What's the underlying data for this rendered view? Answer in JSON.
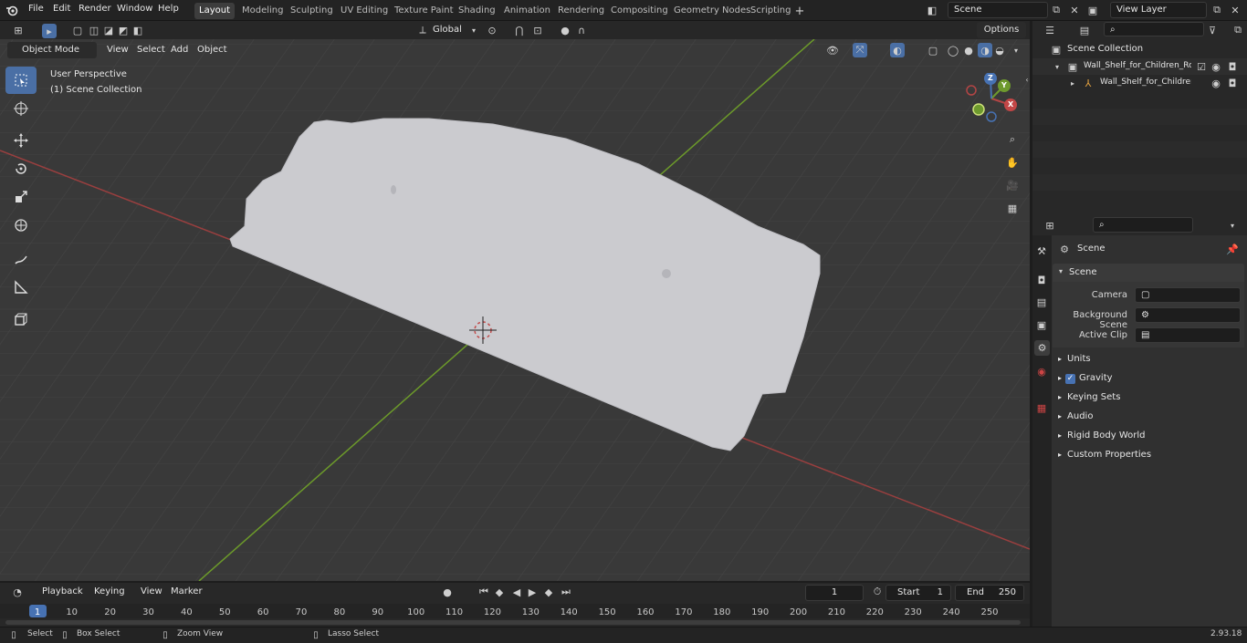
{
  "menu": {
    "items": [
      "File",
      "Edit",
      "Render",
      "Window",
      "Help"
    ]
  },
  "workspaces": [
    "Layout",
    "Modeling",
    "Sculpting",
    "UV Editing",
    "Texture Paint",
    "Shading",
    "Animation",
    "Rendering",
    "Compositing",
    "Geometry Nodes",
    "Scripting"
  ],
  "active_workspace": "Layout",
  "scene_field": "Scene",
  "view_layer_field": "View Layer",
  "header": {
    "transform_orientation": "Global",
    "options": "Options"
  },
  "viewport_header": {
    "mode": "Object Mode",
    "menus": [
      "View",
      "Select",
      "Add",
      "Object"
    ]
  },
  "viewport": {
    "perspective": "User Perspective",
    "collection": "(1) Scene Collection"
  },
  "gizmo": {
    "x": "X",
    "y": "Y",
    "z": "Z"
  },
  "outliner": {
    "root": "Scene Collection",
    "items": [
      "Wall_Shelf_for_Children_Roor",
      "Wall_Shelf_for_Children_I"
    ]
  },
  "properties": {
    "context": "Scene",
    "panel": "Scene",
    "camera_label": "Camera",
    "bg_scene_label": "Background Scene",
    "active_clip_label": "Active Clip",
    "sections": [
      "Units",
      "Gravity",
      "Keying Sets",
      "Audio",
      "Rigid Body World",
      "Custom Properties"
    ],
    "gravity_checked": true
  },
  "timeline": {
    "menus": [
      "Playback",
      "Keying",
      "View",
      "Marker"
    ],
    "current_frame": "1",
    "start_label": "Start",
    "start": "1",
    "end_label": "End",
    "end": "250",
    "ticks": [
      "1",
      "10",
      "20",
      "30",
      "40",
      "50",
      "60",
      "70",
      "80",
      "90",
      "100",
      "110",
      "120",
      "130",
      "140",
      "150",
      "160",
      "170",
      "180",
      "190",
      "200",
      "210",
      "220",
      "230",
      "240",
      "250"
    ]
  },
  "status": {
    "select": "Select",
    "box_select": "Box Select",
    "zoom_view": "Zoom View",
    "lasso_select": "Lasso Select",
    "version": "2.93.18"
  },
  "colors": {
    "accent": "#4772b3",
    "x_axis": "#b34545",
    "y_axis": "#6e9a2e",
    "object": "#cdcdd1"
  }
}
